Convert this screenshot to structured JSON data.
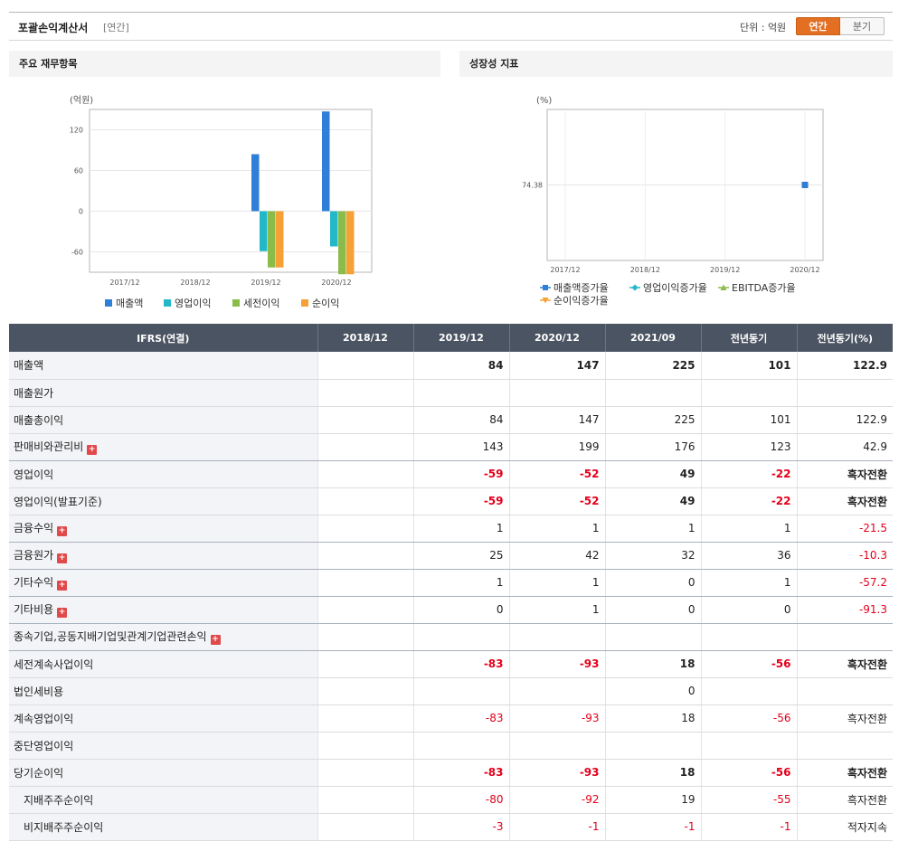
{
  "header": {
    "title": "포괄손익계산서",
    "subtitle": "[연간]",
    "unit_label": "단위 : 억원",
    "toggle_annual": "연간",
    "toggle_quarterly": "분기"
  },
  "left_panel": {
    "title": "주요 재무항목"
  },
  "right_panel": {
    "title": "성장성 지표"
  },
  "chart_data": [
    {
      "type": "bar",
      "ylabel": "(억원)",
      "categories": [
        "2017/12",
        "2018/12",
        "2019/12",
        "2020/12"
      ],
      "yticks": [
        120,
        60,
        0,
        -60
      ],
      "ylim": [
        -90,
        150
      ],
      "grid": true,
      "legend": "bottom",
      "series": [
        {
          "name": "매출액",
          "color": "#2f7ed8",
          "values": [
            null,
            null,
            84,
            147
          ]
        },
        {
          "name": "영업이익",
          "color": "#22b8c8",
          "values": [
            null,
            null,
            -59,
            -52
          ]
        },
        {
          "name": "세전이익",
          "color": "#8bbc4a",
          "values": [
            null,
            null,
            -83,
            -93
          ]
        },
        {
          "name": "순이익",
          "color": "#f5a135",
          "values": [
            null,
            null,
            -83,
            -93
          ]
        }
      ]
    },
    {
      "type": "line",
      "ylabel": "(%)",
      "categories": [
        "2017/12",
        "2018/12",
        "2019/12",
        "2020/12"
      ],
      "yticks": [
        "74.38"
      ],
      "grid": true,
      "legend": "bottom",
      "series": [
        {
          "name": "매출액증가율",
          "color": "#2f7ed8",
          "marker": "square",
          "values": [
            null,
            null,
            null,
            74.38
          ]
        },
        {
          "name": "영업이익증가율",
          "color": "#22b8c8",
          "marker": "diamond",
          "values": [
            null,
            null,
            null,
            null
          ]
        },
        {
          "name": "EBITDA증가율",
          "color": "#8bbc4a",
          "marker": "triangle",
          "values": [
            null,
            null,
            null,
            null
          ]
        },
        {
          "name": "순이익증가율",
          "color": "#f5a135",
          "marker": "triangle-down",
          "values": [
            null,
            null,
            null,
            null
          ]
        }
      ]
    }
  ],
  "table": {
    "columns": [
      "IFRS(연결)",
      "2018/12",
      "2019/12",
      "2020/12",
      "2021/09",
      "전년동기",
      "전년동기(%)"
    ],
    "rows": [
      {
        "label": "매출액",
        "values": [
          "",
          "84",
          "147",
          "225",
          "101",
          "122.9"
        ],
        "bold": true,
        "expand": false
      },
      {
        "label": "매출원가",
        "values": [
          "",
          "",
          "",
          "",
          "",
          ""
        ],
        "bold": false,
        "expand": false
      },
      {
        "label": "매출총이익",
        "values": [
          "",
          "84",
          "147",
          "225",
          "101",
          "122.9"
        ],
        "bold": false,
        "expand": false
      },
      {
        "label": "판매비와관리비",
        "values": [
          "",
          "143",
          "199",
          "176",
          "123",
          "42.9"
        ],
        "bold": false,
        "expand": true,
        "sep": true
      },
      {
        "label": "영업이익",
        "values": [
          "",
          "-59",
          "-52",
          "49",
          "-22",
          "흑자전환"
        ],
        "bold": true,
        "expand": false
      },
      {
        "label": "영업이익(발표기준)",
        "values": [
          "",
          "-59",
          "-52",
          "49",
          "-22",
          "흑자전환"
        ],
        "bold": true,
        "expand": false
      },
      {
        "label": "금융수익",
        "values": [
          "",
          "1",
          "1",
          "1",
          "1",
          "-21.5"
        ],
        "bold": false,
        "expand": true,
        "sep": true
      },
      {
        "label": "금융원가",
        "values": [
          "",
          "25",
          "42",
          "32",
          "36",
          "-10.3"
        ],
        "bold": false,
        "expand": true,
        "sep": true
      },
      {
        "label": "기타수익",
        "values": [
          "",
          "1",
          "1",
          "0",
          "1",
          "-57.2"
        ],
        "bold": false,
        "expand": true,
        "sep": true
      },
      {
        "label": "기타비용",
        "values": [
          "",
          "0",
          "1",
          "0",
          "0",
          "-91.3"
        ],
        "bold": false,
        "expand": true,
        "sep": true
      },
      {
        "label": "종속기업,공동지배기업및관계기업관련손익",
        "values": [
          "",
          "",
          "",
          "",
          "",
          ""
        ],
        "bold": false,
        "expand": true,
        "sep": true
      },
      {
        "label": "세전계속사업이익",
        "values": [
          "",
          "-83",
          "-93",
          "18",
          "-56",
          "흑자전환"
        ],
        "bold": true,
        "expand": false
      },
      {
        "label": "법인세비용",
        "values": [
          "",
          "",
          "",
          "0",
          "",
          ""
        ],
        "bold": false,
        "expand": false
      },
      {
        "label": "계속영업이익",
        "values": [
          "",
          "-83",
          "-93",
          "18",
          "-56",
          "흑자전환"
        ],
        "bold": false,
        "expand": false
      },
      {
        "label": "중단영업이익",
        "values": [
          "",
          "",
          "",
          "",
          "",
          ""
        ],
        "bold": false,
        "expand": false
      },
      {
        "label": "당기순이익",
        "values": [
          "",
          "-83",
          "-93",
          "18",
          "-56",
          "흑자전환"
        ],
        "bold": true,
        "expand": false
      },
      {
        "label": "지배주주순이익",
        "values": [
          "",
          "-80",
          "-92",
          "19",
          "-55",
          "흑자전환"
        ],
        "bold": false,
        "expand": false,
        "sub": true
      },
      {
        "label": "비지배주주순이익",
        "values": [
          "",
          "-3",
          "-1",
          "-1",
          "-1",
          "적자지속"
        ],
        "bold": false,
        "expand": false,
        "sub": true
      }
    ]
  }
}
